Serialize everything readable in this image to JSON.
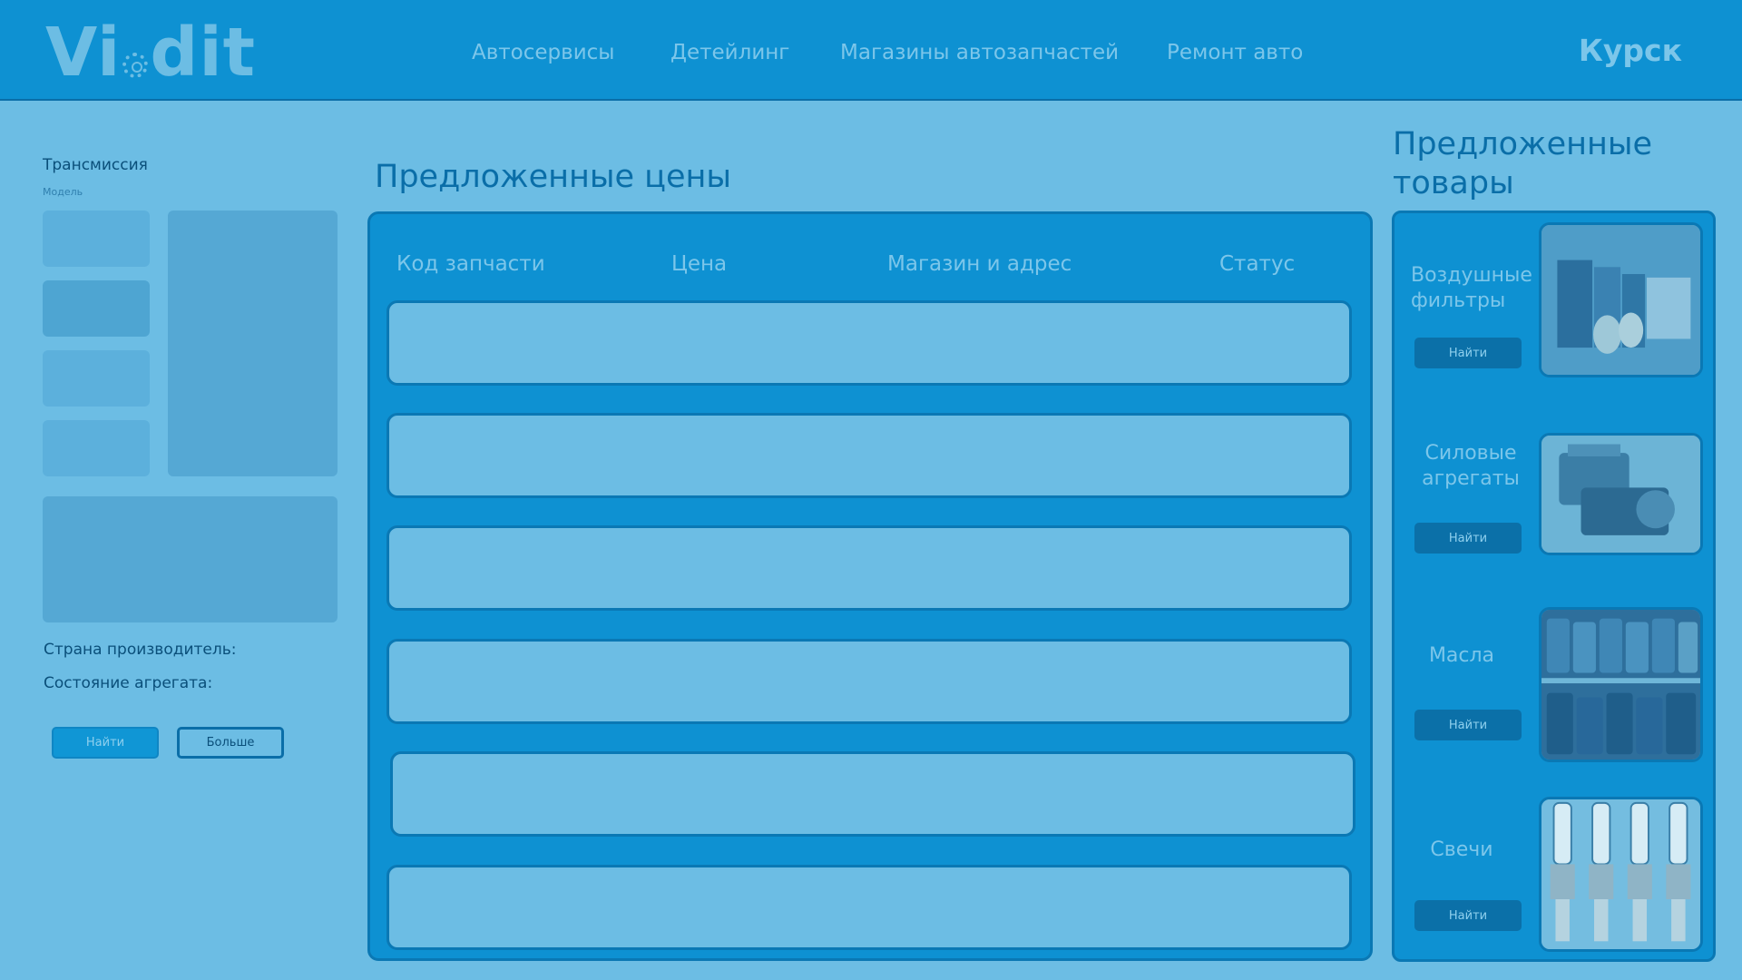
{
  "header": {
    "logo": "Vidit",
    "nav": [
      "Автосервисы",
      "Детейлинг",
      "Магазины автозапчастей",
      "Ремонт авто"
    ],
    "city": "Курск"
  },
  "filters": {
    "title": "Трансмиссия",
    "subtitle": "Модель",
    "country_label": "Страна производитель:",
    "condition_label": "Состояние агрегата:",
    "find_button": "Найти",
    "more_button": "Больше"
  },
  "prices": {
    "title": "Предложенные цены",
    "columns": [
      "Код запчасти",
      "Цена",
      "Магазин и адрес",
      "Статус"
    ],
    "rows": [
      "",
      "",
      "",
      "",
      "",
      ""
    ]
  },
  "goods": {
    "title": "Предложенные товары",
    "items": [
      {
        "label": "Воздушные фильтры",
        "button": "Найти",
        "icon": "air-filters-image"
      },
      {
        "label": "Силовые агрегаты",
        "button": "Найти",
        "icon": "engine-image"
      },
      {
        "label": "Масла",
        "button": "Найти",
        "icon": "oil-bottles-image"
      },
      {
        "label": "Свечи",
        "button": "Найти",
        "icon": "spark-plugs-image"
      }
    ]
  },
  "colors": {
    "background": "#6cbde4",
    "header": "#0e91d2",
    "panel": "#0e91d2",
    "border": "#0a78b4",
    "text_dark": "#0a4f7a",
    "text_light": "#7cc6ea"
  }
}
